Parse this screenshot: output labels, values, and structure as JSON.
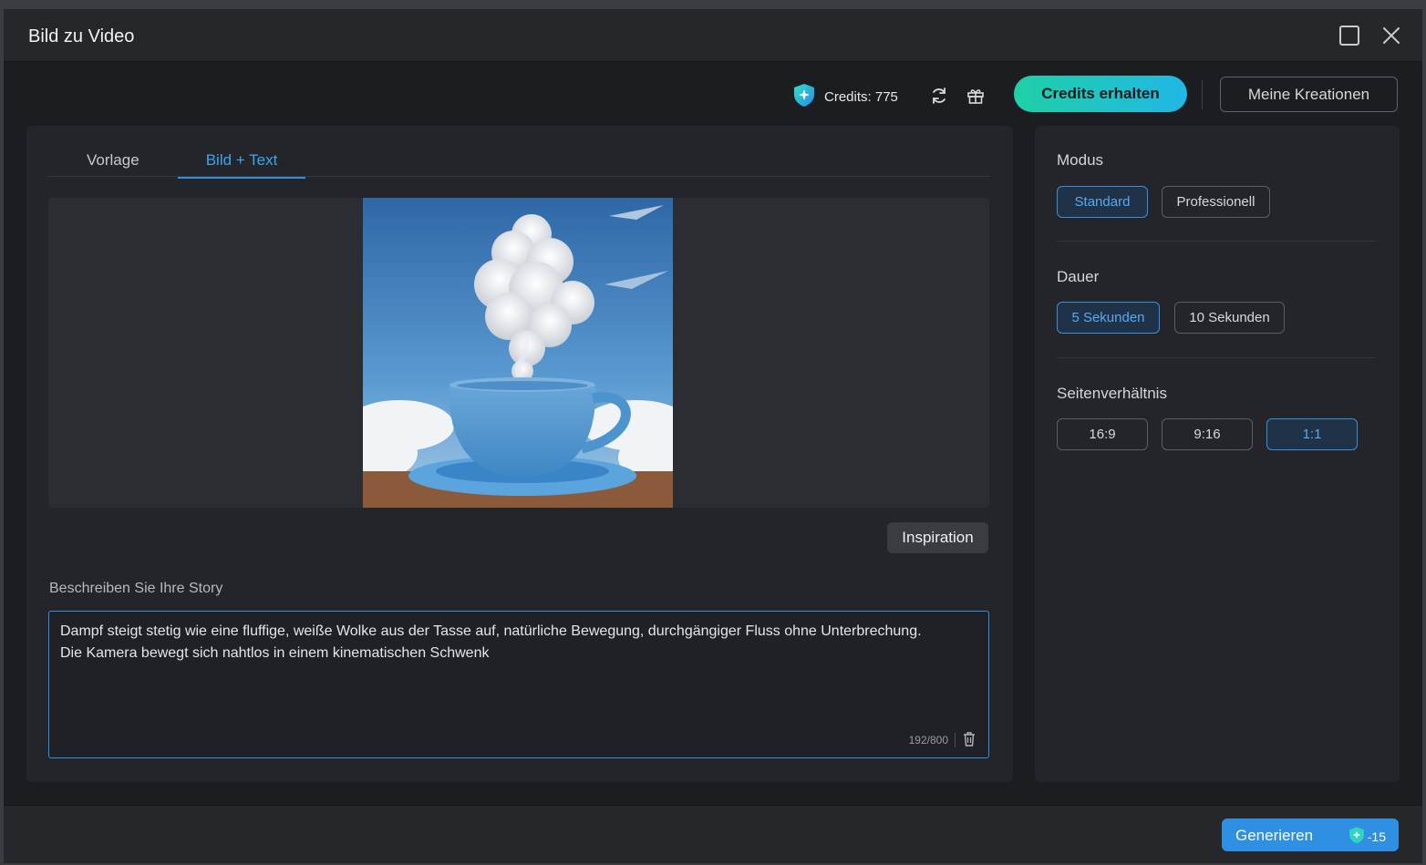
{
  "window": {
    "title": "Bild zu Video"
  },
  "topbar": {
    "credits_label": "Credits: 775",
    "get_credits_label": "Credits erhalten",
    "my_creations_label": "Meine Kreationen"
  },
  "tabs": [
    {
      "label": "Vorlage",
      "active": false
    },
    {
      "label": "Bild + Text",
      "active": true
    }
  ],
  "inspiration_label": "Inspiration",
  "story": {
    "label": "Beschreiben Sie Ihre Story",
    "text": "Dampf steigt stetig wie eine fluffige, weiße Wolke aus der Tasse auf, natürliche Bewegung, durchgängiger Fluss ohne Unterbrechung. Die Kamera bewegt sich nahtlos in einem kinematischen Schwenk",
    "counter": "192/800"
  },
  "settings": {
    "mode": {
      "label": "Modus",
      "options": [
        "Standard",
        "Professionell"
      ],
      "selected": "Standard"
    },
    "duration": {
      "label": "Dauer",
      "options": [
        "5 Sekunden",
        "10 Sekunden"
      ],
      "selected": "5 Sekunden"
    },
    "aspect": {
      "label": "Seitenverhältnis",
      "options": [
        "16:9",
        "9:16",
        "1:1"
      ],
      "selected": "1:1"
    }
  },
  "footer": {
    "generate_label": "Generieren",
    "cost": "-15"
  },
  "colors": {
    "accent": "#2e8fe3",
    "teal": "#1fd0a6",
    "background": "#1b1d21"
  }
}
